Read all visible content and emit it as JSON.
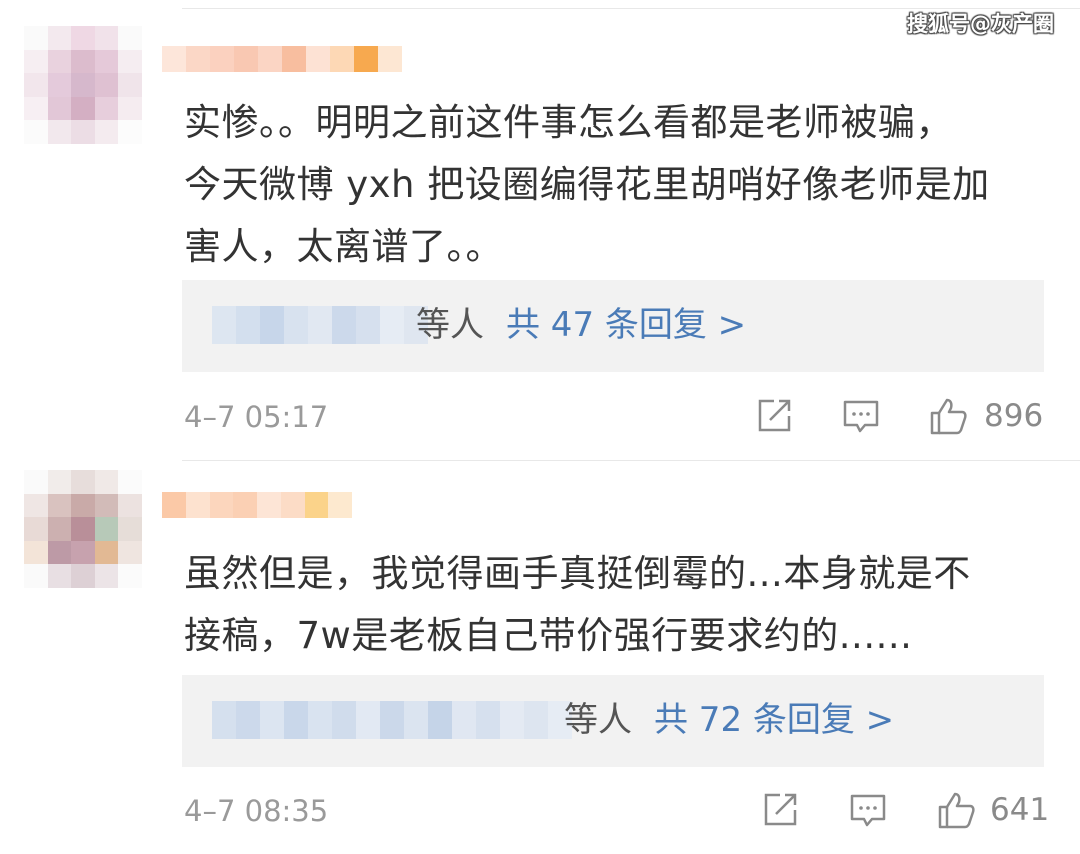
{
  "watermark": "搜狐号@灰产圈",
  "comments": [
    {
      "text": "实惨。。明明之前这件事怎么看都是老师被骗，今天微博 yxh 把设圈编得花里胡哨好像老师是加害人，太离谱了。。",
      "lines": [
        "实惨。。明明之前这件事怎么看都是老师被骗，",
        "今天微博 yxh 把设圈编得花里胡哨好像老师是加",
        "害人，太离谱了。。"
      ],
      "reply_by": "等人",
      "reply_count": "共 47 条回复 >",
      "time": "4–7 05:17",
      "likes": "896",
      "icons": [
        "share-icon",
        "comment-icon",
        "like-icon"
      ]
    },
    {
      "text": "虽然但是，我觉得画手真挺倒霉的...本身就是不接稿，7w是老板自己带价强行要求约的......",
      "lines": [
        "虽然但是，我觉得画手真挺倒霉的...本身就是不",
        "接稿，7w是老板自己带价强行要求约的......"
      ],
      "reply_by": "等人",
      "reply_count": "共 72 条回复 >",
      "time": "4–7 08:35",
      "likes": "641",
      "icons": [
        "share-icon",
        "comment-icon",
        "like-icon"
      ]
    }
  ],
  "colors": {
    "link": "#4a7bb7",
    "reply_bg": "#f2f2f2",
    "meta": "#9a9a9a"
  }
}
